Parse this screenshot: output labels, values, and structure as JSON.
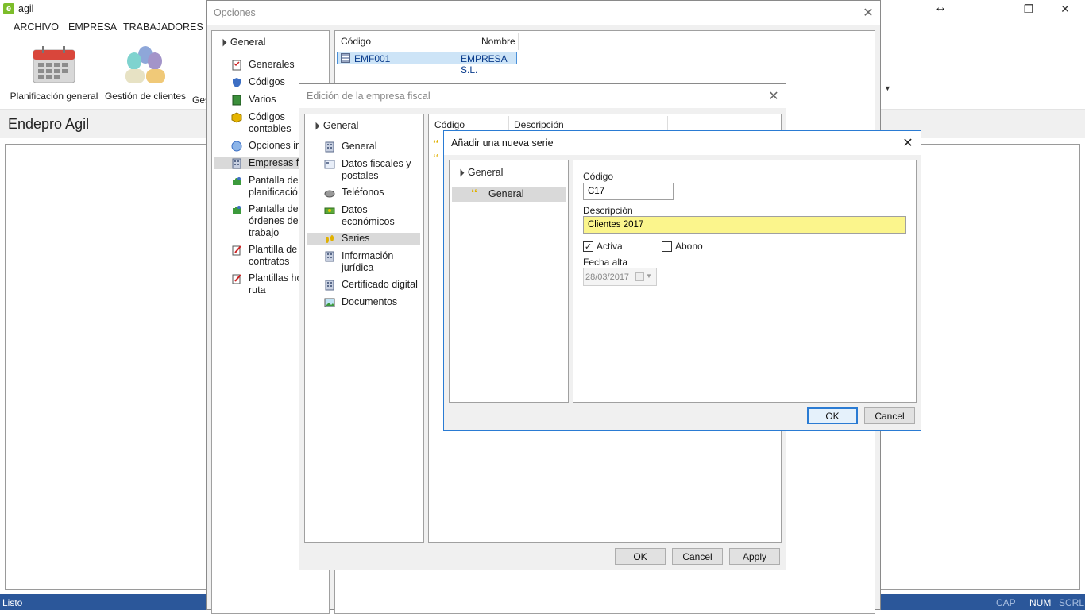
{
  "app": {
    "title": "agil",
    "menu": [
      "ARCHIVO",
      "EMPRESA",
      "TRABAJADORES"
    ],
    "ribbon": [
      "Planificación general",
      "Gestión de clientes",
      "Ges"
    ],
    "page_title": "Endepro Agil"
  },
  "status_bar": {
    "left": "Listo",
    "indicators": [
      "CAP",
      "NUM",
      "SCRL"
    ]
  },
  "opciones": {
    "title": "Opciones",
    "tree_root": "General",
    "tree_items": [
      {
        "label": "Generales",
        "icon": "checklist-icon"
      },
      {
        "label": "Códigos",
        "icon": "shield-icon"
      },
      {
        "label": "Varios",
        "icon": "book-icon"
      },
      {
        "label": "Códigos\ncontables",
        "icon": "cube-icon"
      },
      {
        "label": "Opciones in",
        "icon": "globe-icon"
      },
      {
        "label": "Empresas fis",
        "icon": "building-icon"
      },
      {
        "label": "Pantalla de l\nplanificació",
        "icon": "puzzle-icon"
      },
      {
        "label": "Pantalla de l\nórdenes de\ntrabajo",
        "icon": "puzzle-icon"
      },
      {
        "label": "Plantilla de\ncontratos",
        "icon": "pencil-doc-icon"
      },
      {
        "label": "Plantillas ho\nruta",
        "icon": "pencil-doc-icon"
      }
    ],
    "table": {
      "headers": [
        "Código",
        "Nombre"
      ],
      "rows": [
        {
          "codigo": "EMF001",
          "nombre": "EMPRESA S.L."
        }
      ]
    }
  },
  "edicion": {
    "title": "Edición de la empresa fiscal",
    "tree_root": "General",
    "tree_items": [
      {
        "label": "General",
        "icon": "building-icon"
      },
      {
        "label": "Datos fiscales y\npostales",
        "icon": "address-card-icon"
      },
      {
        "label": "Teléfonos",
        "icon": "phone-icon"
      },
      {
        "label": "Datos\neconómicos",
        "icon": "money-icon"
      },
      {
        "label": "Series",
        "icon": "footprints-icon"
      },
      {
        "label": "Información\njurídica",
        "icon": "building-icon"
      },
      {
        "label": "Certificado digital",
        "icon": "building-icon"
      },
      {
        "label": "Documentos",
        "icon": "picture-icon"
      }
    ],
    "table": {
      "headers": [
        "Código",
        "Descripción"
      ]
    },
    "buttons": {
      "ok": "OK",
      "cancel": "Cancel",
      "apply": "Apply"
    }
  },
  "nueva_serie": {
    "title": "Añadir una nueva serie",
    "tree_root": "General",
    "tree_item": "General",
    "fields": {
      "codigo_label": "Código",
      "codigo_value": "C17",
      "descripcion_label": "Descripción",
      "descripcion_value": "Clientes 2017",
      "activa_label": "Activa",
      "activa_checked": true,
      "abono_label": "Abono",
      "abono_checked": false,
      "fecha_label": "Fecha alta",
      "fecha_value": "28/03/2017"
    },
    "buttons": {
      "ok": "OK",
      "cancel": "Cancel"
    }
  },
  "colors": {
    "accent": "#2a7bd3",
    "status_bar": "#2b579a",
    "highlight_field": "#fbf58c",
    "selection": "#cde4f7"
  }
}
